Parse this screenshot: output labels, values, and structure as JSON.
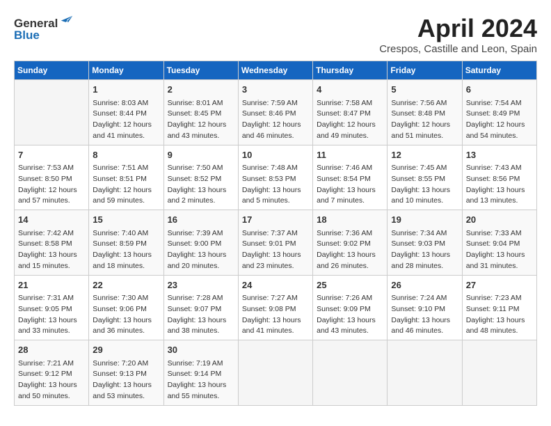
{
  "header": {
    "logo_general": "General",
    "logo_blue": "Blue",
    "month_title": "April 2024",
    "location": "Crespos, Castille and Leon, Spain"
  },
  "days_of_week": [
    "Sunday",
    "Monday",
    "Tuesday",
    "Wednesday",
    "Thursday",
    "Friday",
    "Saturday"
  ],
  "weeks": [
    [
      {
        "day": "",
        "info": ""
      },
      {
        "day": "1",
        "info": "Sunrise: 8:03 AM\nSunset: 8:44 PM\nDaylight: 12 hours\nand 41 minutes."
      },
      {
        "day": "2",
        "info": "Sunrise: 8:01 AM\nSunset: 8:45 PM\nDaylight: 12 hours\nand 43 minutes."
      },
      {
        "day": "3",
        "info": "Sunrise: 7:59 AM\nSunset: 8:46 PM\nDaylight: 12 hours\nand 46 minutes."
      },
      {
        "day": "4",
        "info": "Sunrise: 7:58 AM\nSunset: 8:47 PM\nDaylight: 12 hours\nand 49 minutes."
      },
      {
        "day": "5",
        "info": "Sunrise: 7:56 AM\nSunset: 8:48 PM\nDaylight: 12 hours\nand 51 minutes."
      },
      {
        "day": "6",
        "info": "Sunrise: 7:54 AM\nSunset: 8:49 PM\nDaylight: 12 hours\nand 54 minutes."
      }
    ],
    [
      {
        "day": "7",
        "info": "Sunrise: 7:53 AM\nSunset: 8:50 PM\nDaylight: 12 hours\nand 57 minutes."
      },
      {
        "day": "8",
        "info": "Sunrise: 7:51 AM\nSunset: 8:51 PM\nDaylight: 12 hours\nand 59 minutes."
      },
      {
        "day": "9",
        "info": "Sunrise: 7:50 AM\nSunset: 8:52 PM\nDaylight: 13 hours\nand 2 minutes."
      },
      {
        "day": "10",
        "info": "Sunrise: 7:48 AM\nSunset: 8:53 PM\nDaylight: 13 hours\nand 5 minutes."
      },
      {
        "day": "11",
        "info": "Sunrise: 7:46 AM\nSunset: 8:54 PM\nDaylight: 13 hours\nand 7 minutes."
      },
      {
        "day": "12",
        "info": "Sunrise: 7:45 AM\nSunset: 8:55 PM\nDaylight: 13 hours\nand 10 minutes."
      },
      {
        "day": "13",
        "info": "Sunrise: 7:43 AM\nSunset: 8:56 PM\nDaylight: 13 hours\nand 13 minutes."
      }
    ],
    [
      {
        "day": "14",
        "info": "Sunrise: 7:42 AM\nSunset: 8:58 PM\nDaylight: 13 hours\nand 15 minutes."
      },
      {
        "day": "15",
        "info": "Sunrise: 7:40 AM\nSunset: 8:59 PM\nDaylight: 13 hours\nand 18 minutes."
      },
      {
        "day": "16",
        "info": "Sunrise: 7:39 AM\nSunset: 9:00 PM\nDaylight: 13 hours\nand 20 minutes."
      },
      {
        "day": "17",
        "info": "Sunrise: 7:37 AM\nSunset: 9:01 PM\nDaylight: 13 hours\nand 23 minutes."
      },
      {
        "day": "18",
        "info": "Sunrise: 7:36 AM\nSunset: 9:02 PM\nDaylight: 13 hours\nand 26 minutes."
      },
      {
        "day": "19",
        "info": "Sunrise: 7:34 AM\nSunset: 9:03 PM\nDaylight: 13 hours\nand 28 minutes."
      },
      {
        "day": "20",
        "info": "Sunrise: 7:33 AM\nSunset: 9:04 PM\nDaylight: 13 hours\nand 31 minutes."
      }
    ],
    [
      {
        "day": "21",
        "info": "Sunrise: 7:31 AM\nSunset: 9:05 PM\nDaylight: 13 hours\nand 33 minutes."
      },
      {
        "day": "22",
        "info": "Sunrise: 7:30 AM\nSunset: 9:06 PM\nDaylight: 13 hours\nand 36 minutes."
      },
      {
        "day": "23",
        "info": "Sunrise: 7:28 AM\nSunset: 9:07 PM\nDaylight: 13 hours\nand 38 minutes."
      },
      {
        "day": "24",
        "info": "Sunrise: 7:27 AM\nSunset: 9:08 PM\nDaylight: 13 hours\nand 41 minutes."
      },
      {
        "day": "25",
        "info": "Sunrise: 7:26 AM\nSunset: 9:09 PM\nDaylight: 13 hours\nand 43 minutes."
      },
      {
        "day": "26",
        "info": "Sunrise: 7:24 AM\nSunset: 9:10 PM\nDaylight: 13 hours\nand 46 minutes."
      },
      {
        "day": "27",
        "info": "Sunrise: 7:23 AM\nSunset: 9:11 PM\nDaylight: 13 hours\nand 48 minutes."
      }
    ],
    [
      {
        "day": "28",
        "info": "Sunrise: 7:21 AM\nSunset: 9:12 PM\nDaylight: 13 hours\nand 50 minutes."
      },
      {
        "day": "29",
        "info": "Sunrise: 7:20 AM\nSunset: 9:13 PM\nDaylight: 13 hours\nand 53 minutes."
      },
      {
        "day": "30",
        "info": "Sunrise: 7:19 AM\nSunset: 9:14 PM\nDaylight: 13 hours\nand 55 minutes."
      },
      {
        "day": "",
        "info": ""
      },
      {
        "day": "",
        "info": ""
      },
      {
        "day": "",
        "info": ""
      },
      {
        "day": "",
        "info": ""
      }
    ]
  ]
}
